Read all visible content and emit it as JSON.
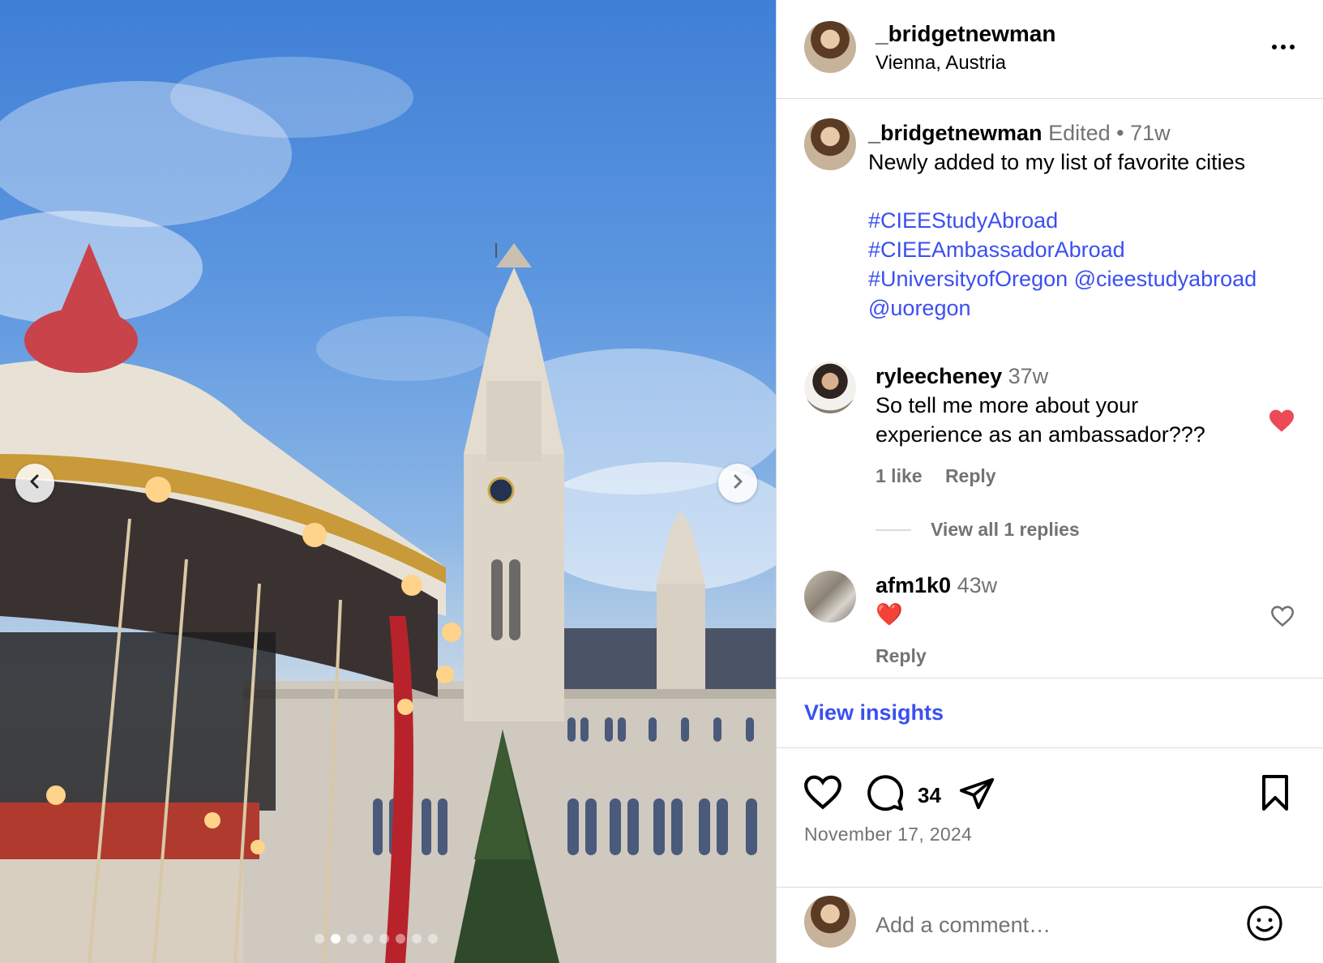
{
  "post": {
    "author": "_bridgetnewman",
    "location": "Vienna, Austria",
    "edited": "Edited",
    "separator": "•",
    "age": "71w",
    "caption_text": "Newly added to my list of favorite cities",
    "hashtags": [
      "#CIEEStudyAbroad",
      "#CIEEAmbassadorAbroad",
      "#UniversityofOregon"
    ],
    "mention_1": "@cieestudyabroad",
    "mention_2": "@uoregon"
  },
  "comments": [
    {
      "user": "ryleecheney",
      "age": "37w",
      "text_line_1": "So tell me more about your",
      "text_line_2": "experience as an ambassador???",
      "likes": "1 like",
      "reply": "Reply",
      "liked": true,
      "replies_label": "View all 1 replies"
    },
    {
      "user": "afm1k0",
      "age": "43w",
      "text": "❤️",
      "reply": "Reply",
      "liked": false
    }
  ],
  "insights_label": "View insights",
  "actions": {
    "comment_count": "34",
    "icons": [
      "heart-icon",
      "comment-icon",
      "share-icon",
      "bookmark-icon"
    ]
  },
  "date": "November 17, 2024",
  "add_comment": {
    "placeholder": "Add a comment…"
  },
  "carousel": {
    "total_slides": 8,
    "active_slide": 2
  },
  "colors": {
    "link_blue": "#3b4ff0",
    "liked_red": "#ed4956",
    "muted_gray": "#737373",
    "border": "#dbdbdb"
  }
}
